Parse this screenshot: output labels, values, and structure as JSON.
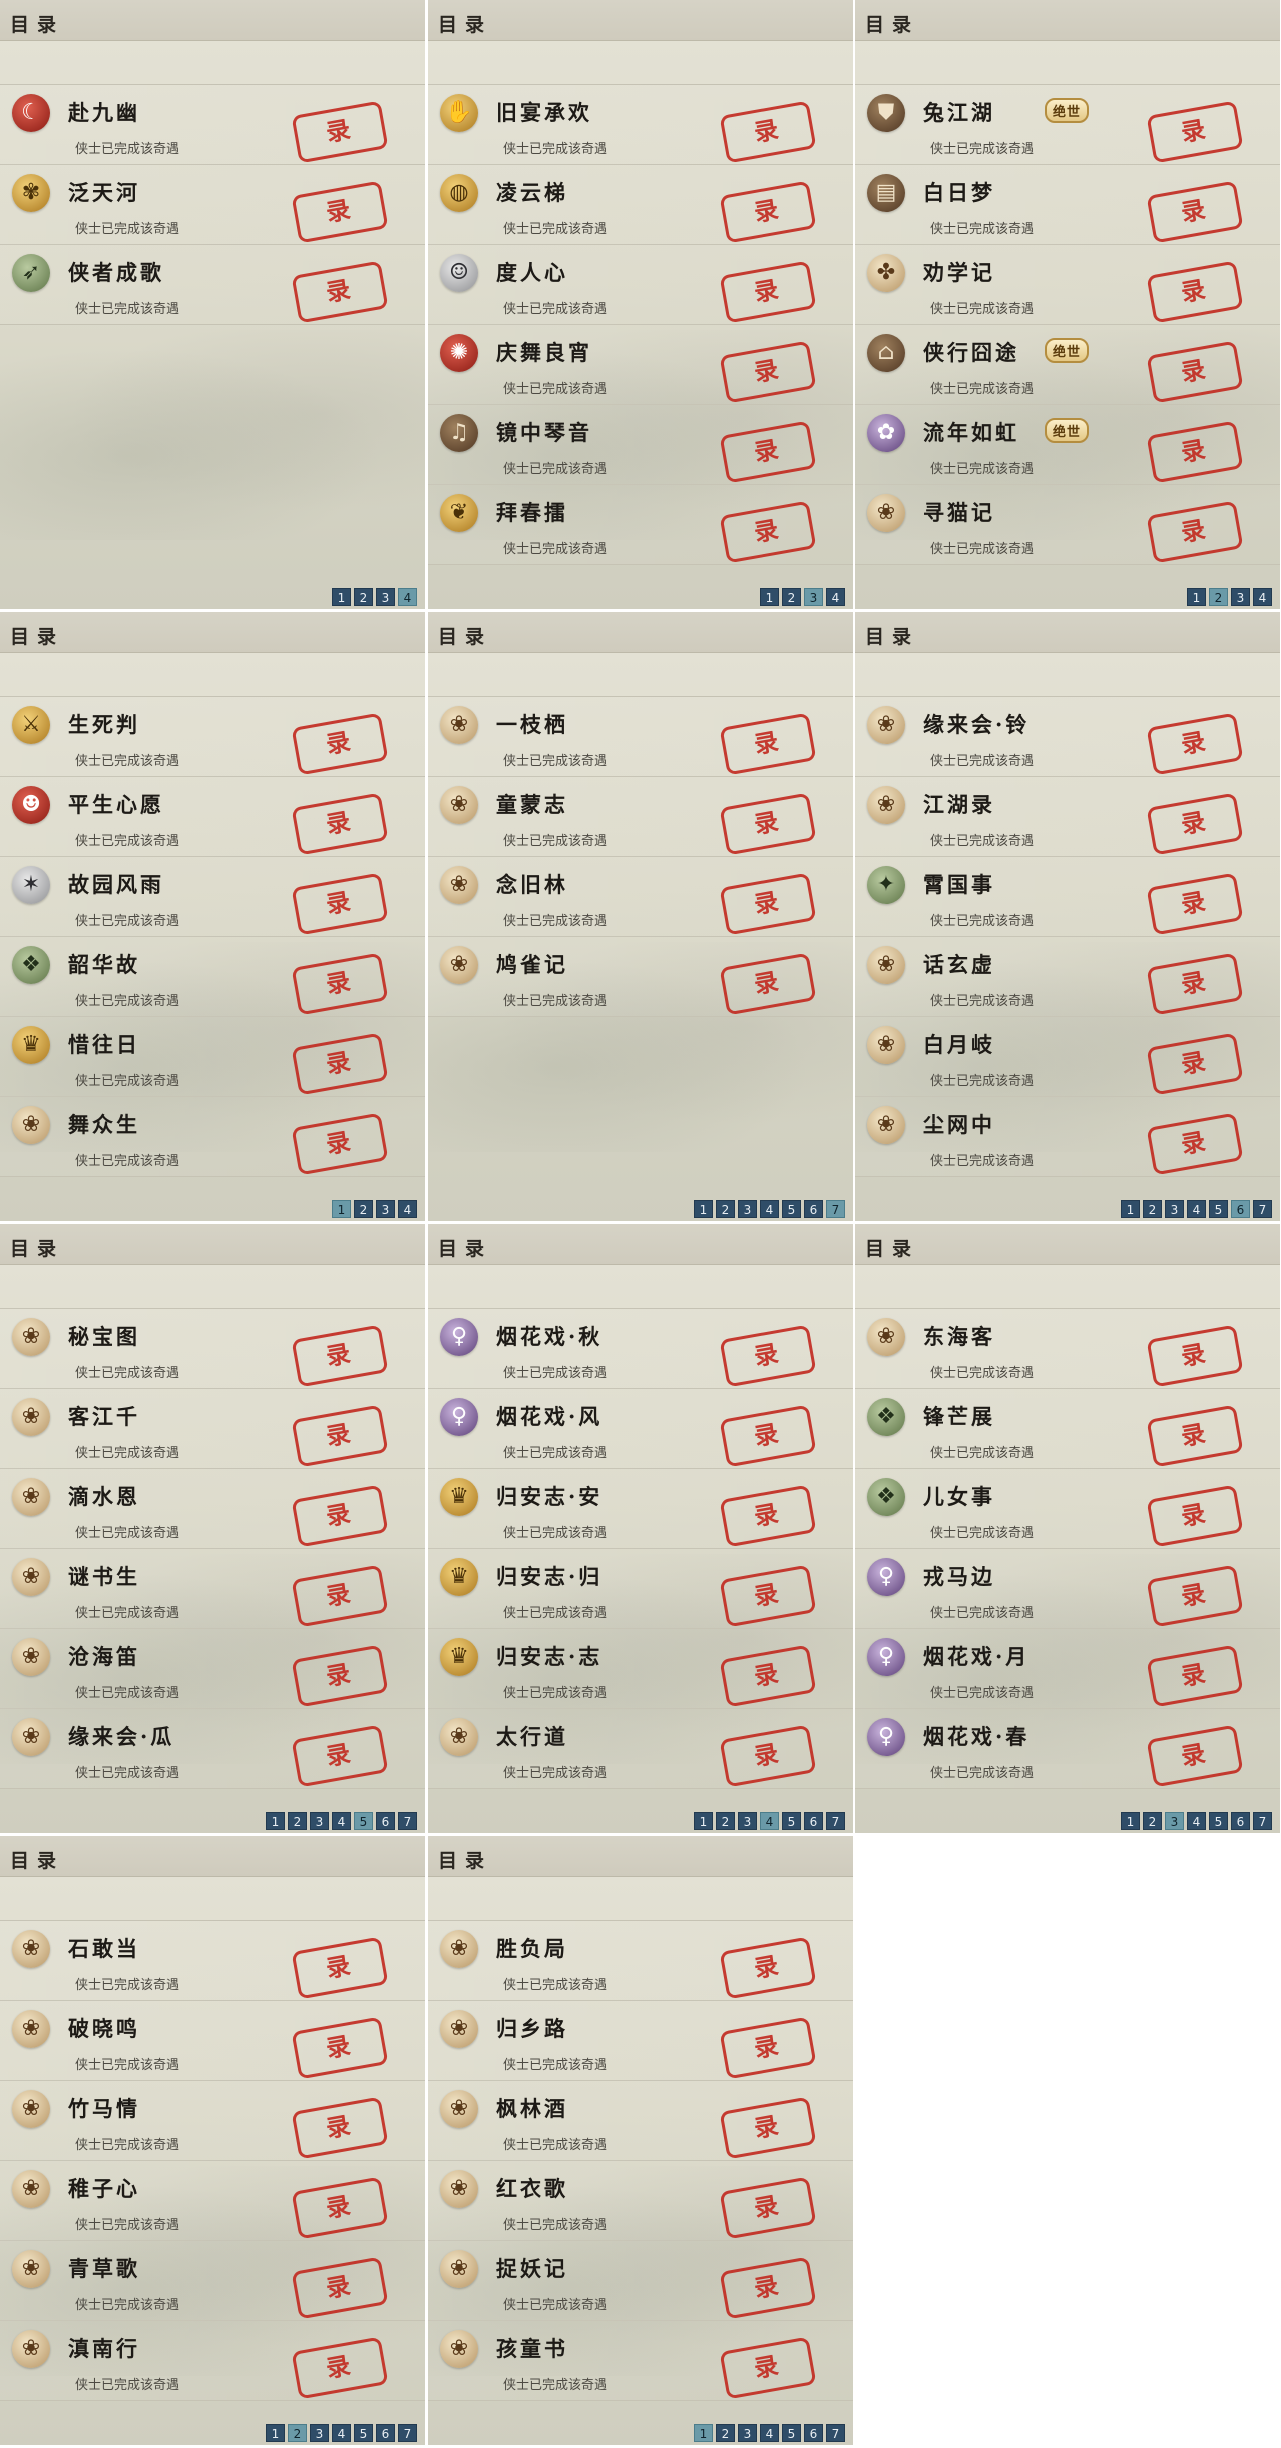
{
  "stamp_text": "录",
  "panels": [
    {
      "title": "目录",
      "pages": [
        "1",
        "2",
        "3",
        "4"
      ],
      "active_page": "4",
      "entries": [
        {
          "title": "赴九幽",
          "desc": "侠士已完成该奇遇",
          "icon": "red-moon-icon",
          "icon_glyph": "☾"
        },
        {
          "title": "泛天河",
          "desc": "侠士已完成该奇遇",
          "icon": "butterfly-icon",
          "icon_glyph": "✾"
        },
        {
          "title": "侠者成歌",
          "desc": "侠士已完成该奇遇",
          "icon": "bow-icon",
          "icon_glyph": "➶"
        }
      ]
    },
    {
      "title": "目录",
      "pages": [
        "1",
        "2",
        "3",
        "4"
      ],
      "active_page": "3",
      "entries": [
        {
          "title": "旧宴承欢",
          "desc": "侠士已完成该奇遇",
          "icon": "hand-icon",
          "icon_glyph": "✋"
        },
        {
          "title": "凌云梯",
          "desc": "侠士已完成该奇遇",
          "icon": "cookie-icon",
          "icon_glyph": "◍"
        },
        {
          "title": "度人心",
          "desc": "侠士已完成该奇遇",
          "icon": "mask-icon",
          "icon_glyph": "☺"
        },
        {
          "title": "庆舞良宵",
          "desc": "侠士已完成该奇遇",
          "icon": "lion-head-icon",
          "icon_glyph": "✺"
        },
        {
          "title": "镜中琴音",
          "desc": "侠士已完成该奇遇",
          "icon": "zither-icon",
          "icon_glyph": "♫"
        },
        {
          "title": "拜春擂",
          "desc": "侠士已完成该奇遇",
          "icon": "rabbit-icon",
          "icon_glyph": "❦"
        }
      ]
    },
    {
      "title": "目录",
      "pages": [
        "1",
        "2",
        "3",
        "4"
      ],
      "active_page": "2",
      "entries": [
        {
          "title": "兔江湖",
          "badge": "绝世",
          "desc": "侠士已完成该奇遇",
          "icon": "shield-icon",
          "icon_glyph": "⛊"
        },
        {
          "title": "白日梦",
          "desc": "侠士已完成该奇遇",
          "icon": "bed-icon",
          "icon_glyph": "▤"
        },
        {
          "title": "劝学记",
          "desc": "侠士已完成该奇遇",
          "icon": "paw-icon",
          "icon_glyph": "✤"
        },
        {
          "title": "侠行囧途",
          "badge": "绝世",
          "desc": "侠士已完成该奇遇",
          "icon": "pavilion-icon",
          "icon_glyph": "⌂"
        },
        {
          "title": "流年如虹",
          "badge": "绝世",
          "desc": "侠士已完成该奇遇",
          "icon": "flower-icon",
          "icon_glyph": "✿"
        },
        {
          "title": "寻猫记",
          "desc": "侠士已完成该奇遇",
          "icon": "cat-icon",
          "icon_glyph": "❀"
        }
      ]
    },
    {
      "title": "目录",
      "pages": [
        "1",
        "2",
        "3",
        "4"
      ],
      "active_page": "1",
      "entries": [
        {
          "title": "生死判",
          "desc": "侠士已完成该奇遇",
          "icon": "sword-icon",
          "icon_glyph": "⚔"
        },
        {
          "title": "平生心愿",
          "desc": "侠士已完成该奇遇",
          "icon": "doll-icon",
          "icon_glyph": "☻"
        },
        {
          "title": "故园风雨",
          "desc": "侠士已完成该奇遇",
          "icon": "fan-icon",
          "icon_glyph": "✶"
        },
        {
          "title": "韶华故",
          "desc": "侠士已完成该奇遇",
          "icon": "jade-icon",
          "icon_glyph": "❖"
        },
        {
          "title": "惜往日",
          "desc": "侠士已完成该奇遇",
          "icon": "gold-figure-icon",
          "icon_glyph": "♛"
        },
        {
          "title": "舞众生",
          "desc": "侠士已完成该奇遇",
          "icon": "cat-icon",
          "icon_glyph": "❀"
        }
      ]
    },
    {
      "title": "目录",
      "pages": [
        "1",
        "2",
        "3",
        "4",
        "5",
        "6",
        "7"
      ],
      "active_page": "7",
      "entries": [
        {
          "title": "一枝栖",
          "desc": "侠士已完成该奇遇",
          "icon": "cat-icon",
          "icon_glyph": "❀"
        },
        {
          "title": "童蒙志",
          "desc": "侠士已完成该奇遇",
          "icon": "cat-icon",
          "icon_glyph": "❀"
        },
        {
          "title": "念旧林",
          "desc": "侠士已完成该奇遇",
          "icon": "cat-icon",
          "icon_glyph": "❀"
        },
        {
          "title": "鸠雀记",
          "desc": "侠士已完成该奇遇",
          "icon": "cat-icon",
          "icon_glyph": "❀"
        }
      ]
    },
    {
      "title": "目录",
      "pages": [
        "1",
        "2",
        "3",
        "4",
        "5",
        "6",
        "7"
      ],
      "active_page": "6",
      "entries": [
        {
          "title": "缘来会·铃",
          "desc": "侠士已完成该奇遇",
          "icon": "cat-icon",
          "icon_glyph": "❀"
        },
        {
          "title": "江湖录",
          "desc": "侠士已完成该奇遇",
          "icon": "cat-icon",
          "icon_glyph": "❀"
        },
        {
          "title": "霄国事",
          "desc": "侠士已完成该奇遇",
          "icon": "dragon-icon",
          "icon_glyph": "✦"
        },
        {
          "title": "话玄虚",
          "desc": "侠士已完成该奇遇",
          "icon": "cat-icon",
          "icon_glyph": "❀"
        },
        {
          "title": "白月岐",
          "desc": "侠士已完成该奇遇",
          "icon": "cat-icon",
          "icon_glyph": "❀"
        },
        {
          "title": "尘网中",
          "desc": "侠士已完成该奇遇",
          "icon": "cat-icon",
          "icon_glyph": "❀"
        }
      ]
    },
    {
      "title": "目录",
      "pages": [
        "1",
        "2",
        "3",
        "4",
        "5",
        "6",
        "7"
      ],
      "active_page": "5",
      "entries": [
        {
          "title": "秘宝图",
          "desc": "侠士已完成该奇遇",
          "icon": "cat-icon",
          "icon_glyph": "❀"
        },
        {
          "title": "客江千",
          "desc": "侠士已完成该奇遇",
          "icon": "cat-icon",
          "icon_glyph": "❀"
        },
        {
          "title": "滴水恩",
          "desc": "侠士已完成该奇遇",
          "icon": "cat-icon",
          "icon_glyph": "❀"
        },
        {
          "title": "谜书生",
          "desc": "侠士已完成该奇遇",
          "icon": "cat-icon",
          "icon_glyph": "❀"
        },
        {
          "title": "沧海笛",
          "desc": "侠士已完成该奇遇",
          "icon": "cat-icon",
          "icon_glyph": "❀"
        },
        {
          "title": "缘来会·瓜",
          "desc": "侠士已完成该奇遇",
          "icon": "cat-icon",
          "icon_glyph": "❀"
        }
      ]
    },
    {
      "title": "目录",
      "pages": [
        "1",
        "2",
        "3",
        "4",
        "5",
        "6",
        "7"
      ],
      "active_page": "4",
      "entries": [
        {
          "title": "烟花戏·秋",
          "desc": "侠士已完成该奇遇",
          "icon": "lady-icon",
          "icon_glyph": "♀"
        },
        {
          "title": "烟花戏·风",
          "desc": "侠士已完成该奇遇",
          "icon": "lady-icon",
          "icon_glyph": "♀"
        },
        {
          "title": "归安志·安",
          "desc": "侠士已完成该奇遇",
          "icon": "gold-figure-icon",
          "icon_glyph": "♛"
        },
        {
          "title": "归安志·归",
          "desc": "侠士已完成该奇遇",
          "icon": "gold-figure-icon",
          "icon_glyph": "♛"
        },
        {
          "title": "归安志·志",
          "desc": "侠士已完成该奇遇",
          "icon": "gold-figure-icon",
          "icon_glyph": "♛"
        },
        {
          "title": "太行道",
          "desc": "侠士已完成该奇遇",
          "icon": "cat-icon",
          "icon_glyph": "❀"
        }
      ]
    },
    {
      "title": "目录",
      "pages": [
        "1",
        "2",
        "3",
        "4",
        "5",
        "6",
        "7"
      ],
      "active_page": "3",
      "entries": [
        {
          "title": "东海客",
          "desc": "侠士已完成该奇遇",
          "icon": "cat-icon",
          "icon_glyph": "❀"
        },
        {
          "title": "锋芒展",
          "desc": "侠士已完成该奇遇",
          "icon": "jade-icon",
          "icon_glyph": "❖"
        },
        {
          "title": "儿女事",
          "desc": "侠士已完成该奇遇",
          "icon": "jade-icon",
          "icon_glyph": "❖"
        },
        {
          "title": "戎马边",
          "desc": "侠士已完成该奇遇",
          "icon": "lady-icon",
          "icon_glyph": "♀"
        },
        {
          "title": "烟花戏·月",
          "desc": "侠士已完成该奇遇",
          "icon": "lady-icon",
          "icon_glyph": "♀"
        },
        {
          "title": "烟花戏·春",
          "desc": "侠士已完成该奇遇",
          "icon": "lady-icon",
          "icon_glyph": "♀"
        }
      ]
    },
    {
      "title": "目录",
      "pages": [
        "1",
        "2",
        "3",
        "4",
        "5",
        "6",
        "7"
      ],
      "active_page": "2",
      "entries": [
        {
          "title": "石敢当",
          "desc": "侠士已完成该奇遇",
          "icon": "cat-icon",
          "icon_glyph": "❀"
        },
        {
          "title": "破晓鸣",
          "desc": "侠士已完成该奇遇",
          "icon": "cat-icon",
          "icon_glyph": "❀"
        },
        {
          "title": "竹马情",
          "desc": "侠士已完成该奇遇",
          "icon": "cat-icon",
          "icon_glyph": "❀"
        },
        {
          "title": "稚子心",
          "desc": "侠士已完成该奇遇",
          "icon": "cat-icon",
          "icon_glyph": "❀"
        },
        {
          "title": "青草歌",
          "desc": "侠士已完成该奇遇",
          "icon": "cat-icon",
          "icon_glyph": "❀"
        },
        {
          "title": "滇南行",
          "desc": "侠士已完成该奇遇",
          "icon": "cat-icon",
          "icon_glyph": "❀"
        }
      ]
    },
    {
      "title": "目录",
      "pages": [
        "1",
        "2",
        "3",
        "4",
        "5",
        "6",
        "7"
      ],
      "active_page": "1",
      "entries": [
        {
          "title": "胜负局",
          "desc": "侠士已完成该奇遇",
          "icon": "cat-icon",
          "icon_glyph": "❀"
        },
        {
          "title": "归乡路",
          "desc": "侠士已完成该奇遇",
          "icon": "cat-icon",
          "icon_glyph": "❀"
        },
        {
          "title": "枫林酒",
          "desc": "侠士已完成该奇遇",
          "icon": "cat-icon",
          "icon_glyph": "❀"
        },
        {
          "title": "红衣歌",
          "desc": "侠士已完成该奇遇",
          "icon": "cat-icon",
          "icon_glyph": "❀"
        },
        {
          "title": "捉妖记",
          "desc": "侠士已完成该奇遇",
          "icon": "cat-icon",
          "icon_glyph": "❀"
        },
        {
          "title": "孩童书",
          "desc": "侠士已完成该奇遇",
          "icon": "cat-icon",
          "icon_glyph": "❀"
        }
      ]
    }
  ]
}
